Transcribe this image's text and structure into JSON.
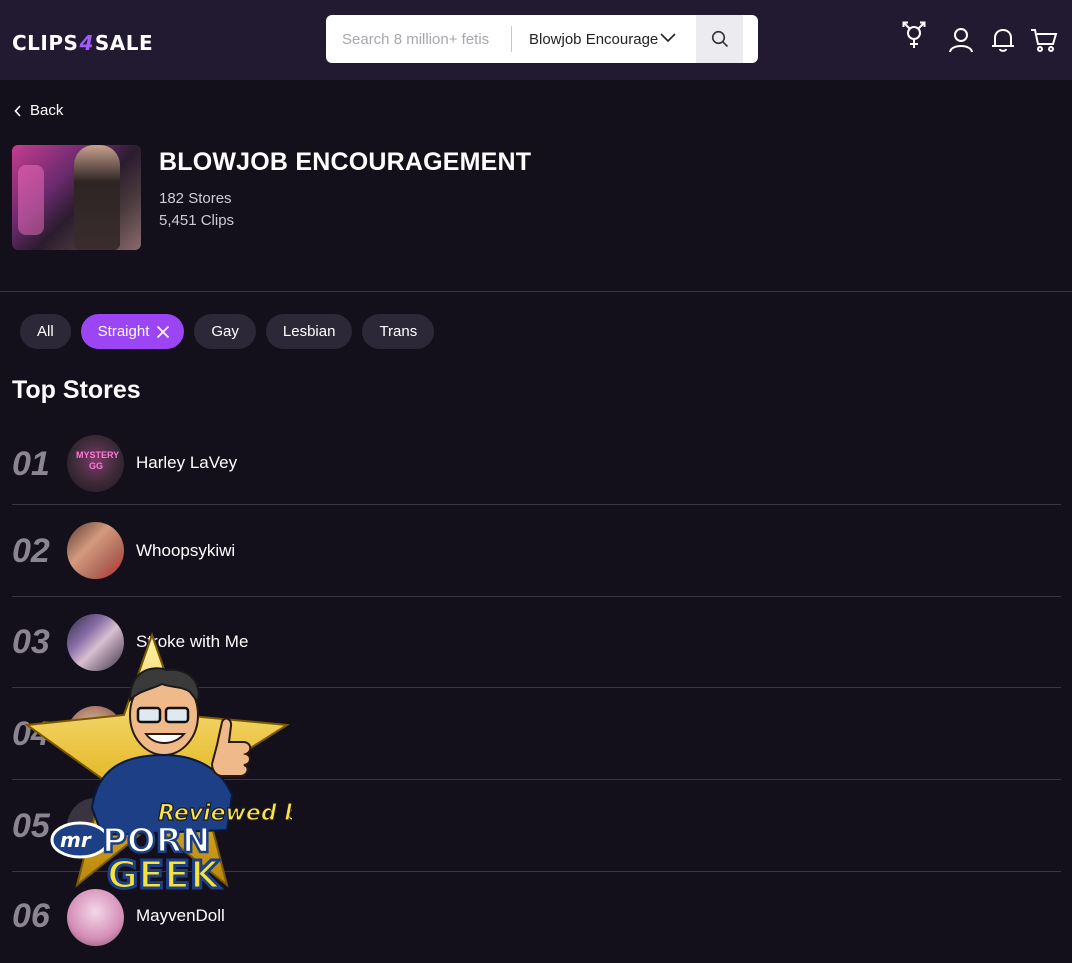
{
  "header": {
    "logo_left": "CLIPS",
    "logo_bolt": "4",
    "logo_right": "SALE",
    "search_placeholder": "Search 8 million+ fetis",
    "category_selected": "Blowjob Encourage",
    "icons": [
      "gender-icon",
      "user-icon",
      "bell-icon",
      "cart-icon"
    ]
  },
  "nav": {
    "back_label": "Back"
  },
  "category": {
    "title": "BLOWJOB ENCOURAGEMENT",
    "stores": "182 Stores",
    "clips": "5,451 Clips"
  },
  "filters": {
    "items": [
      {
        "label": "All",
        "active": false
      },
      {
        "label": "Straight",
        "active": true
      },
      {
        "label": "Gay",
        "active": false
      },
      {
        "label": "Lesbian",
        "active": false
      },
      {
        "label": "Trans",
        "active": false
      }
    ]
  },
  "top_stores": {
    "title": "Top Stores",
    "items": [
      {
        "rank": "01",
        "name": "Harley LaVey",
        "avatar_text": "MYSTERY GG"
      },
      {
        "rank": "02",
        "name": "Whoopsykiwi"
      },
      {
        "rank": "03",
        "name": "Stroke with Me"
      },
      {
        "rank": "04",
        "name": ""
      },
      {
        "rank": "05",
        "name": ""
      },
      {
        "rank": "06",
        "name": "MayvenDoll"
      }
    ]
  },
  "overlay": {
    "line1": "Reviewed by",
    "brand_a": "mr",
    "brand_b": "PORN",
    "brand_c": "GEEK"
  },
  "colors": {
    "accent": "#9b45f5",
    "background": "#13101c",
    "header": "#221a30",
    "chip": "#2d2838"
  }
}
